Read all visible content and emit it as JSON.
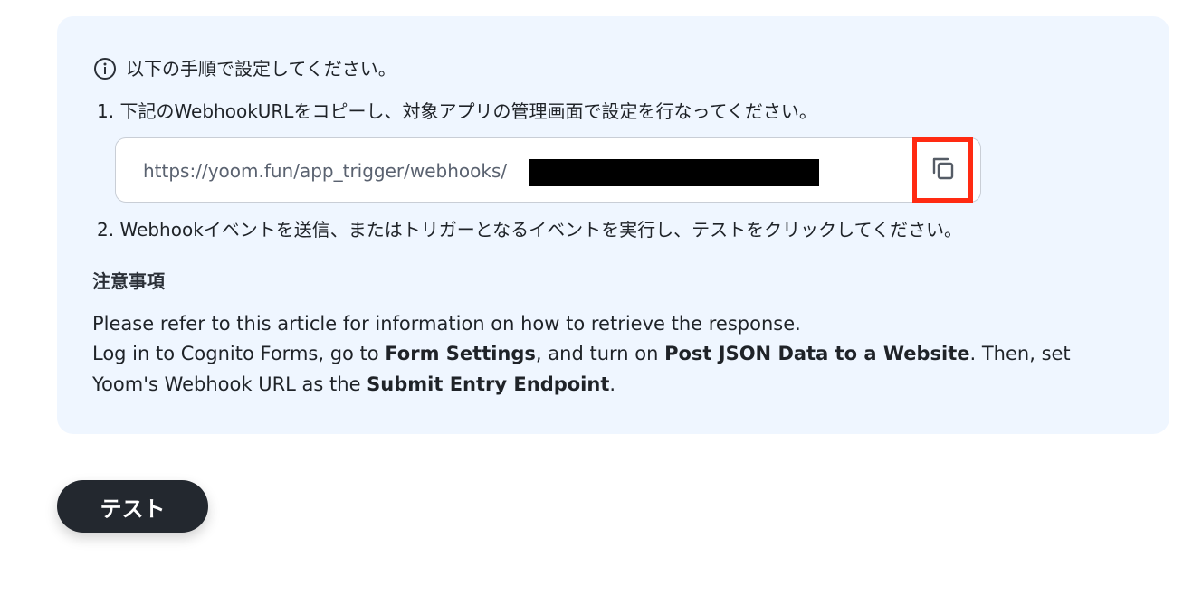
{
  "instructions": {
    "intro": "以下の手順で設定してください。",
    "step1": "1. 下記のWebhookURLをコピーし、対象アプリの管理画面で設定を行なってください。",
    "webhook_url": "https://yoom.fun/app_trigger/webhooks/",
    "copy_icon": "copy-icon",
    "step2": "2. Webhookイベントを送信、またはトリガーとなるイベントを実行し、テストをクリックしてください。"
  },
  "notes": {
    "heading": "注意事項",
    "line1_prefix": "Please refer to ",
    "line1_link": "this article",
    "line1_suffix": " for information on how to retrieve the response.",
    "line2_a": "Log in to Cognito Forms, go to ",
    "line2_b": "Form Settings",
    "line2_c": ", and turn on ",
    "line2_d": "Post JSON Data to a Website",
    "line2_e": ". Then, set",
    "line3_a": "Yoom's Webhook URL as the ",
    "line3_b": "Submit Entry Endpoint",
    "line3_c": "."
  },
  "actions": {
    "test_label": "テスト"
  },
  "colors": {
    "panel_bg": "#eff6ff",
    "highlight": "#ff2a12",
    "button_bg": "#23282f"
  }
}
